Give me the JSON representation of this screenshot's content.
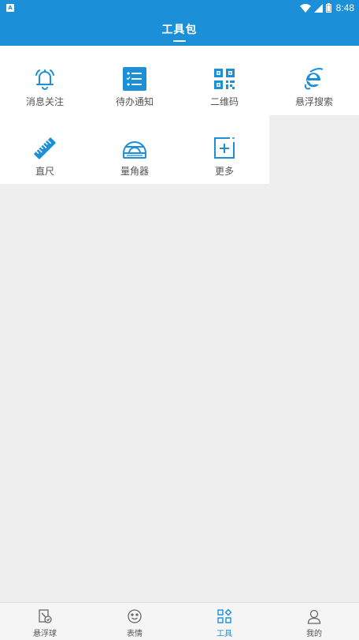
{
  "status_bar": {
    "notif_letter": "A",
    "time": "8:48"
  },
  "header": {
    "title": "工具包"
  },
  "colors": {
    "accent": "#1b8fd7",
    "background": "#eeeeee",
    "text": "#555555"
  },
  "tools": [
    {
      "label": "消息关注",
      "icon": "bell-icon"
    },
    {
      "label": "待办通知",
      "icon": "todo-list-icon"
    },
    {
      "label": "二维码",
      "icon": "qrcode-icon"
    },
    {
      "label": "悬浮搜索",
      "icon": "browser-e-icon"
    },
    {
      "label": "直尺",
      "icon": "ruler-icon"
    },
    {
      "label": "量角器",
      "icon": "protractor-icon"
    },
    {
      "label": "更多",
      "icon": "add-more-icon"
    }
  ],
  "bottom_nav": [
    {
      "label": "悬浮球",
      "icon": "float-ball-icon",
      "active": false
    },
    {
      "label": "表情",
      "icon": "smile-icon",
      "active": false
    },
    {
      "label": "工具",
      "icon": "tools-grid-icon",
      "active": true
    },
    {
      "label": "我的",
      "icon": "user-icon",
      "active": false
    }
  ]
}
